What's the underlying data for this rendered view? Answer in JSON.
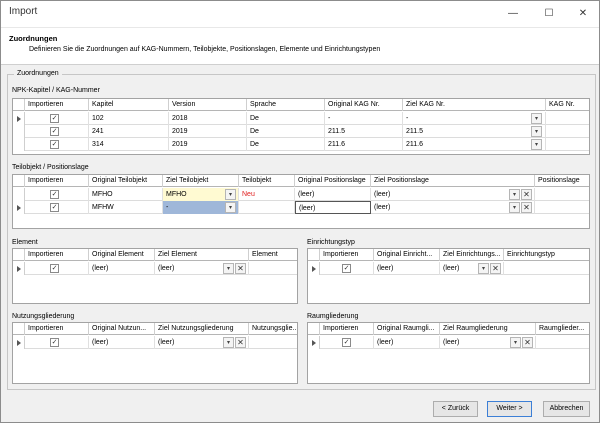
{
  "window": {
    "title": "Import",
    "minimize": "—",
    "maximize": "☐",
    "close": "✕"
  },
  "header": {
    "title": "Zuordnungen",
    "subtitle": "Definieren Sie die Zuordnungen auf KAG-Nummern, Teilobjekte, Positionslagen, Elemente und Einrichtungstypen"
  },
  "group": {
    "title": "Zuordnungen"
  },
  "kag": {
    "label": "NPK-Kapitel / KAG-Nummer",
    "headers": [
      "Importieren",
      "Kapitel",
      "Version",
      "Sprache",
      "Original KAG Nr.",
      "Ziel KAG Nr.",
      "KAG Nr."
    ],
    "rows": [
      {
        "kapitel": "102",
        "version": "2018",
        "sprache": "De",
        "orig": "-",
        "ziel": "-",
        "kag": ""
      },
      {
        "kapitel": "241",
        "version": "2019",
        "sprache": "De",
        "orig": "211.5",
        "ziel": "211.5",
        "kag": ""
      },
      {
        "kapitel": "314",
        "version": "2019",
        "sprache": "De",
        "orig": "211.6",
        "ziel": "211.6",
        "kag": ""
      }
    ]
  },
  "teil": {
    "label": "Teilobjekt / Positionslage",
    "headers": [
      "Importieren",
      "Original Teilobjekt",
      "Ziel Teilobjekt",
      "Teilobjekt",
      "Original Positionslage",
      "Ziel Positionslage",
      "Positionslage"
    ],
    "rows": [
      {
        "orig": "MFHO",
        "ziel": "MFHO",
        "teil": "Neu",
        "origpos": "(leer)",
        "zielpos": "(leer)",
        "pos": ""
      },
      {
        "orig": "MFHW",
        "ziel": "-",
        "teil": "",
        "origpos": "(leer)",
        "zielpos": "(leer)",
        "pos": ""
      }
    ]
  },
  "element": {
    "label": "Element",
    "headers": [
      "Importieren",
      "Original Element",
      "Ziel Element",
      "Element"
    ],
    "rows": [
      {
        "orig": "(leer)",
        "ziel": "(leer)",
        "val": ""
      }
    ]
  },
  "einr": {
    "label": "Einrichtungstyp",
    "headers": [
      "Importieren",
      "Original Einricht...",
      "Ziel Einrichtungs...",
      "Einrichtungstyp"
    ],
    "rows": [
      {
        "orig": "(leer)",
        "ziel": "(leer)",
        "val": ""
      }
    ]
  },
  "nutz": {
    "label": "Nutzungsgliederung",
    "headers": [
      "Importieren",
      "Original Nutzun...",
      "Ziel Nutzungsgliederung",
      "Nutzungsglie..."
    ],
    "rows": [
      {
        "orig": "(leer)",
        "ziel": "(leer)",
        "val": ""
      }
    ]
  },
  "raum": {
    "label": "Raumgliederung",
    "headers": [
      "Importieren",
      "Original Raumgli...",
      "Ziel Raumgliederung",
      "Raumglieder..."
    ],
    "rows": [
      {
        "orig": "(leer)",
        "ziel": "(leer)",
        "val": ""
      }
    ]
  },
  "footer": {
    "back": "< Zurück",
    "next": "Weiter >",
    "cancel": "Abbrechen"
  },
  "icons": {
    "check": "✓",
    "dropdown": "▾",
    "clear": "✕"
  },
  "colors": {
    "highlight": "#fffad2",
    "selected": "#9fb7d9",
    "red": "#e02020"
  }
}
